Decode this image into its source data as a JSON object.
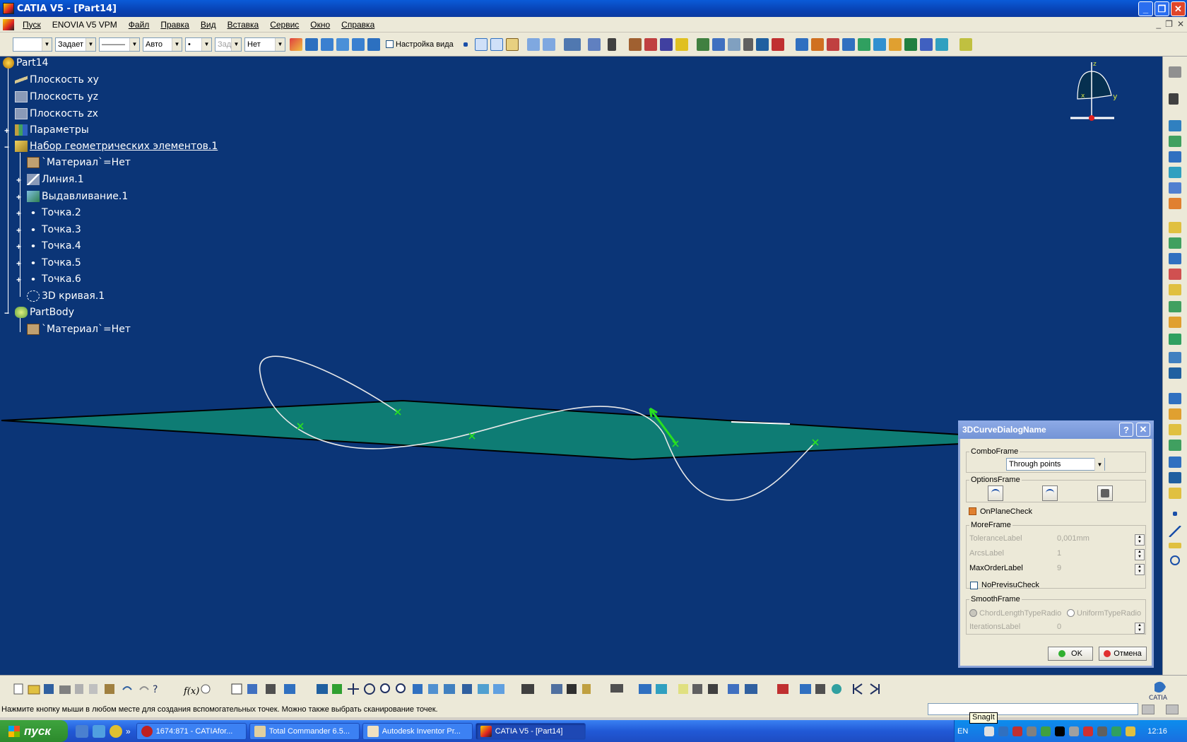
{
  "window": {
    "title": "CATIA V5 - [Part14]"
  },
  "menu": {
    "items": [
      "Пуск",
      "ENOVIA V5 VPM",
      "Файл",
      "Правка",
      "Вид",
      "Вставка",
      "Сервис",
      "Окно",
      "Справка"
    ]
  },
  "toolbar": {
    "color_combo": "",
    "line_type_combo": "Задает",
    "line_style_combo": "———",
    "thickness_combo": "Авто",
    "point_combo": "•",
    "layer_combo_disabled": "Зад",
    "layer_combo": "Нет",
    "view_settings_label": "Настройка вида"
  },
  "tree": {
    "root": "Part14",
    "items": [
      "Плоскость xy",
      "Плоскость yz",
      "Плоскость zx",
      "Параметры",
      "Набор геометрических элементов.1",
      "`Материал`=Нет",
      "Линия.1",
      "Выдавливание.1",
      "Точка.2",
      "Точка.3",
      "Точка.4",
      "Точка.5",
      "Точка.6",
      "3D кривая.1",
      "PartBody",
      "`Материал`=Нет"
    ]
  },
  "compass": {
    "z": "z",
    "x": "x",
    "y": "y"
  },
  "dialog": {
    "title": "3DCurveDialogName",
    "combo_frame": "ComboFrame",
    "combo_value": "Through points",
    "options_frame": "OptionsFrame",
    "on_plane_check": "OnPlaneCheck",
    "more_frame": "MoreFrame",
    "tolerance_label": "ToleranceLabel",
    "tolerance_value": "0,001mm",
    "arcs_label": "ArcsLabel",
    "arcs_value": "1",
    "max_order_label": "MaxOrderLabel",
    "max_order_value": "9",
    "no_previous_check": "NoPrevisuCheck",
    "smooth_frame": "SmoothFrame",
    "chord_radio": "ChordLengthTypeRadio",
    "uniform_radio": "UniformTypeRadio",
    "iterations_label": "IterationsLabel",
    "iterations_value": "0",
    "ok": "OK",
    "cancel": "Отмена"
  },
  "status": {
    "message": "Нажмите кнопку мыши в любом месте для создания вспомогательных точек. Можно также выбрать сканирование точек."
  },
  "tooltip": "SnagIt",
  "taskbar": {
    "start": "пуск",
    "tasks": [
      "1674:871 - CATIAfor...",
      "Total Commander 6.5...",
      "Autodesk Inventor Pr...",
      "CATIA V5 - [Part14]"
    ],
    "lang": "EN",
    "clock": "12:16"
  },
  "colors": {
    "viewport": "#0b3577",
    "plane": "#0e7c74",
    "curve": "#e8e8e8",
    "point": "#29e020",
    "titlebar": "#0a5bd8"
  }
}
